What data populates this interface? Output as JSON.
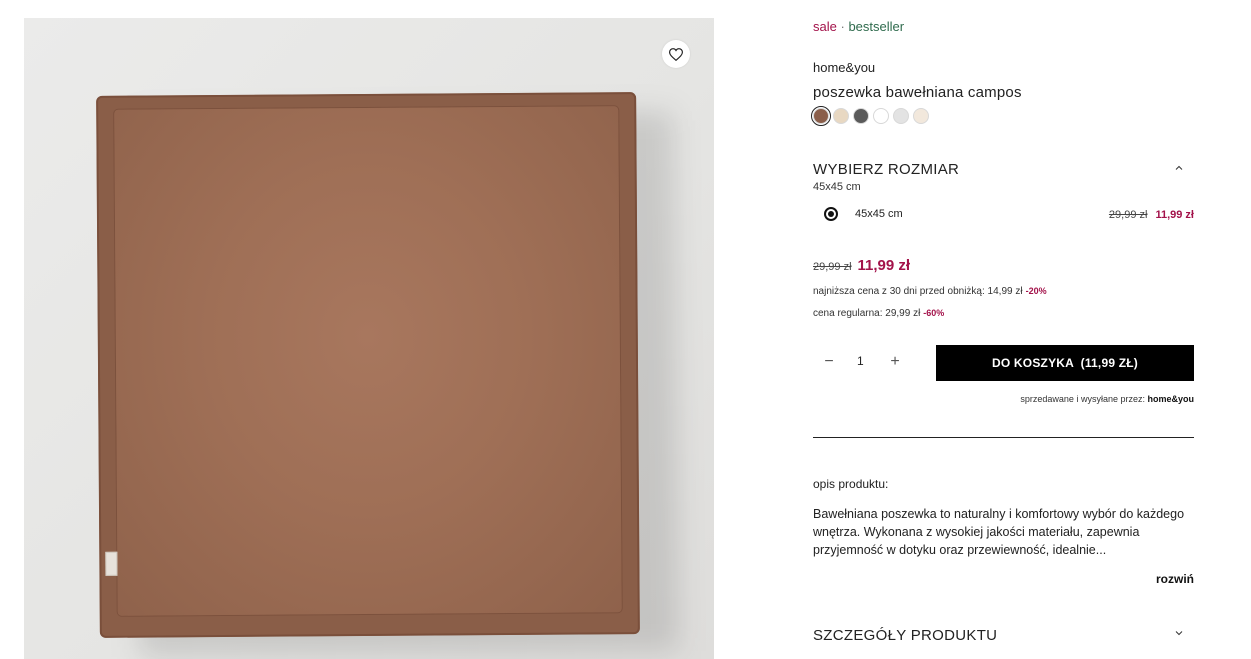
{
  "product": {
    "tags": {
      "sale": "sale",
      "separator": "·",
      "bestseller": "bestseller"
    },
    "brand": "home&you",
    "title": "poszewka bawełniana campos",
    "swatches": [
      {
        "color": "#8a5e4a",
        "active": true
      },
      {
        "color": "#e8d8c2"
      },
      {
        "color": "#5a5a5a"
      },
      {
        "color": "#ffffff"
      },
      {
        "color": "#e3e3e3"
      },
      {
        "color": "#f2e8dc"
      }
    ]
  },
  "size": {
    "title": "WYBIERZ ROZMIAR",
    "selected": "45x45 cm",
    "options": [
      {
        "label": "45x45 cm",
        "old_price": "29,99 zł",
        "new_price": "11,99 zł"
      }
    ]
  },
  "price": {
    "old": "29,99 zł",
    "new": "11,99 zł",
    "lowest_label": "najniższa cena z 30 dni przed obniżką: 14,99 zł",
    "lowest_pct": "-20%",
    "regular_label": "cena regularna: 29,99 zł",
    "regular_pct": "-60%"
  },
  "cart": {
    "minus": "−",
    "quantity": "1",
    "plus": "+",
    "button_label": "DO KOSZYKA  (11,99 ZŁ)",
    "seller_prefix": "sprzedawane i wysyłane przez:",
    "seller_name": "home&you"
  },
  "description": {
    "heading": "opis produktu:",
    "text": "Bawełniana poszewka to naturalny i komfortowy wybór do każdego wnętrza. Wykonana z wysokiej jakości materiału, zapewnia przyjemność w dotyku oraz przewiewność, idealnie...",
    "expand_label": "rozwiń"
  },
  "details": {
    "title": "SZCZEGÓŁY PRODUKTU"
  },
  "colors": {
    "accent": "#a3124a",
    "tag_green": "#2f6b4d",
    "button_bg": "#000000"
  },
  "icons": {
    "wishlist": "heart-icon",
    "collapse": "chevron-up-icon",
    "expand": "chevron-down-icon"
  }
}
